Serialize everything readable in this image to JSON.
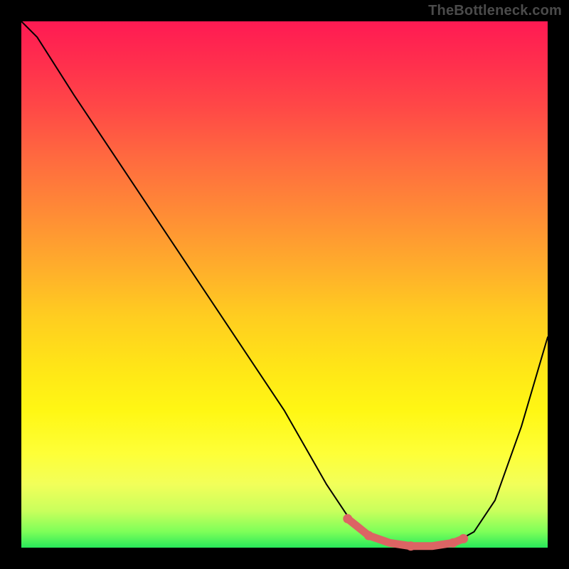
{
  "watermark": "TheBottleneck.com",
  "colors": {
    "page_bg": "#000000",
    "curve": "#000000",
    "highlight": "#dc6464",
    "watermark": "#4b4b4b",
    "gradient_top": "#ff1a53",
    "gradient_bottom": "#28e85a"
  },
  "chart_data": {
    "type": "line",
    "title": "",
    "xlabel": "",
    "ylabel": "",
    "xlim": [
      0,
      100
    ],
    "ylim": [
      0,
      100
    ],
    "grid": false,
    "legend": false,
    "series": [
      {
        "name": "bottleneck-curve",
        "x": [
          0,
          3,
          10,
          20,
          30,
          40,
          50,
          58,
          62,
          66,
          70,
          74,
          78,
          82,
          86,
          90,
          95,
          100
        ],
        "y": [
          100,
          97,
          86,
          71,
          56,
          41,
          26,
          12,
          6,
          2.5,
          0.8,
          0.2,
          0.2,
          0.8,
          3,
          9,
          23,
          40
        ]
      }
    ],
    "highlight": {
      "name": "optimal-range",
      "x_start": 62,
      "x_end": 84,
      "x": [
        62,
        66,
        70,
        74,
        78,
        82,
        84
      ],
      "y": [
        5.5,
        2.3,
        0.9,
        0.3,
        0.3,
        0.9,
        1.7
      ]
    }
  }
}
